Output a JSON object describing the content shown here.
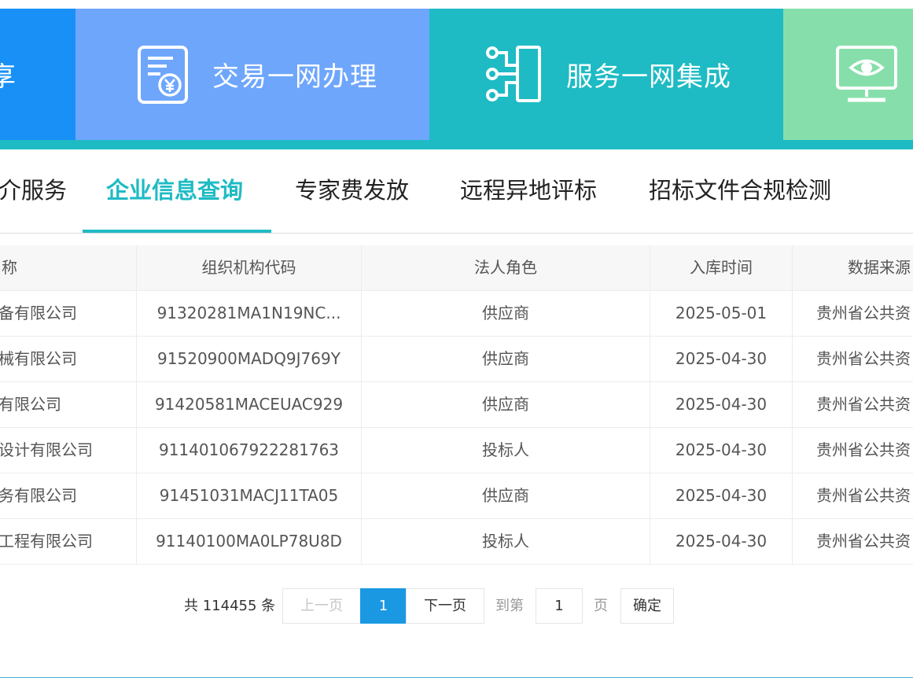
{
  "colors": {
    "tile1": "#1890f6",
    "tile2": "#6ea6fc",
    "tile3": "#1ebbc4",
    "tile4": "#86dfaa",
    "band": "#1ebbc4",
    "accent": "#1ebbc4",
    "pager_active": "#1a98e2",
    "footer_line": "#3fb6d3"
  },
  "banner": {
    "tiles": [
      {
        "label": "享",
        "icon": "share-icon"
      },
      {
        "label": "交易一网办理",
        "icon": "yuan-document-icon"
      },
      {
        "label": "服务一网集成",
        "icon": "integration-icon"
      },
      {
        "label": "",
        "icon": "monitor-eye-icon"
      }
    ]
  },
  "tabs": [
    {
      "label": "介服务",
      "active": false
    },
    {
      "label": "企业信息查询",
      "active": true
    },
    {
      "label": "专家费发放",
      "active": false
    },
    {
      "label": "远程异地评标",
      "active": false
    },
    {
      "label": "招标文件合规检测",
      "active": false
    }
  ],
  "table": {
    "columns": [
      "名称",
      "组织机构代码",
      "法人角色",
      "入库时间",
      "数据来源"
    ],
    "rows": [
      [
        "设备有限公司",
        "91320281MA1N19NC...",
        "供应商",
        "2025-05-01",
        "贵州省公共资"
      ],
      [
        "器械有限公司",
        "91520900MADQ9J769Y",
        "供应商",
        "2025-04-30",
        "贵州省公共资"
      ],
      [
        "萍有限公司",
        "91420581MACEUAC929",
        "供应商",
        "2025-04-30",
        "贵州省公共资"
      ],
      [
        "程设计有限公司",
        "911401067922281763",
        "投标人",
        "2025-04-30",
        "贵州省公共资"
      ],
      [
        "服务有限公司",
        "91451031MACJ11TA05",
        "供应商",
        "2025-04-30",
        "贵州省公共资"
      ],
      [
        "计工程有限公司",
        "91140100MA0LP78U8D",
        "投标人",
        "2025-04-30",
        "贵州省公共资"
      ]
    ]
  },
  "pagination": {
    "total": "共 114455 条",
    "prev": "上一页",
    "current": "1",
    "next": "下一页",
    "goto": "到第",
    "goto_value": "1",
    "page_unit": "页",
    "confirm": "确定"
  }
}
